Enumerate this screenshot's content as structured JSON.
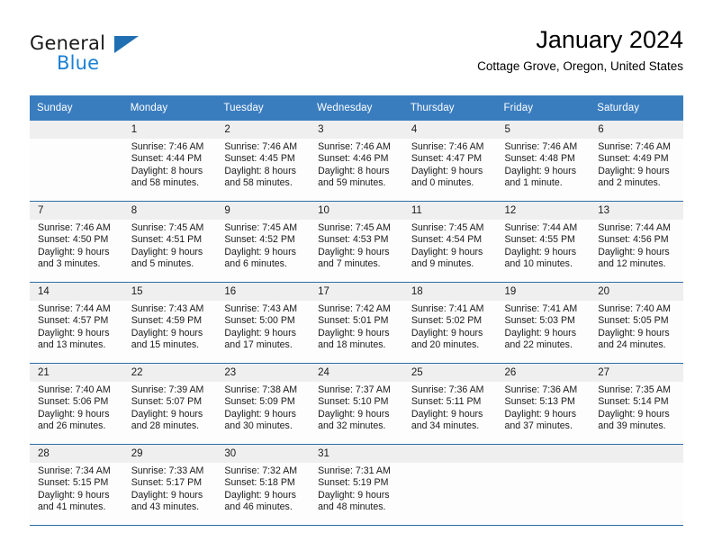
{
  "brand": {
    "name_part1": "General",
    "name_part2": "Blue",
    "accent_color": "#1a7fd4",
    "triangle_color": "#1f6fb2"
  },
  "header": {
    "title": "January 2024",
    "subtitle": "Cottage Grove, Oregon, United States"
  },
  "calendar": {
    "header_bg": "#3a7dbf",
    "daynum_bg": "#efefef",
    "rule_color": "#2c6da8",
    "weekday_headers": [
      "Sunday",
      "Monday",
      "Tuesday",
      "Wednesday",
      "Thursday",
      "Friday",
      "Saturday"
    ],
    "weeks": [
      [
        {
          "day": "",
          "empty": true
        },
        {
          "day": "1",
          "sunrise": "Sunrise: 7:46 AM",
          "sunset": "Sunset: 4:44 PM",
          "daylight1": "Daylight: 8 hours",
          "daylight2": "and 58 minutes."
        },
        {
          "day": "2",
          "sunrise": "Sunrise: 7:46 AM",
          "sunset": "Sunset: 4:45 PM",
          "daylight1": "Daylight: 8 hours",
          "daylight2": "and 58 minutes."
        },
        {
          "day": "3",
          "sunrise": "Sunrise: 7:46 AM",
          "sunset": "Sunset: 4:46 PM",
          "daylight1": "Daylight: 8 hours",
          "daylight2": "and 59 minutes."
        },
        {
          "day": "4",
          "sunrise": "Sunrise: 7:46 AM",
          "sunset": "Sunset: 4:47 PM",
          "daylight1": "Daylight: 9 hours",
          "daylight2": "and 0 minutes."
        },
        {
          "day": "5",
          "sunrise": "Sunrise: 7:46 AM",
          "sunset": "Sunset: 4:48 PM",
          "daylight1": "Daylight: 9 hours",
          "daylight2": "and 1 minute."
        },
        {
          "day": "6",
          "sunrise": "Sunrise: 7:46 AM",
          "sunset": "Sunset: 4:49 PM",
          "daylight1": "Daylight: 9 hours",
          "daylight2": "and 2 minutes."
        }
      ],
      [
        {
          "day": "7",
          "sunrise": "Sunrise: 7:46 AM",
          "sunset": "Sunset: 4:50 PM",
          "daylight1": "Daylight: 9 hours",
          "daylight2": "and 3 minutes."
        },
        {
          "day": "8",
          "sunrise": "Sunrise: 7:45 AM",
          "sunset": "Sunset: 4:51 PM",
          "daylight1": "Daylight: 9 hours",
          "daylight2": "and 5 minutes."
        },
        {
          "day": "9",
          "sunrise": "Sunrise: 7:45 AM",
          "sunset": "Sunset: 4:52 PM",
          "daylight1": "Daylight: 9 hours",
          "daylight2": "and 6 minutes."
        },
        {
          "day": "10",
          "sunrise": "Sunrise: 7:45 AM",
          "sunset": "Sunset: 4:53 PM",
          "daylight1": "Daylight: 9 hours",
          "daylight2": "and 7 minutes."
        },
        {
          "day": "11",
          "sunrise": "Sunrise: 7:45 AM",
          "sunset": "Sunset: 4:54 PM",
          "daylight1": "Daylight: 9 hours",
          "daylight2": "and 9 minutes."
        },
        {
          "day": "12",
          "sunrise": "Sunrise: 7:44 AM",
          "sunset": "Sunset: 4:55 PM",
          "daylight1": "Daylight: 9 hours",
          "daylight2": "and 10 minutes."
        },
        {
          "day": "13",
          "sunrise": "Sunrise: 7:44 AM",
          "sunset": "Sunset: 4:56 PM",
          "daylight1": "Daylight: 9 hours",
          "daylight2": "and 12 minutes."
        }
      ],
      [
        {
          "day": "14",
          "sunrise": "Sunrise: 7:44 AM",
          "sunset": "Sunset: 4:57 PM",
          "daylight1": "Daylight: 9 hours",
          "daylight2": "and 13 minutes."
        },
        {
          "day": "15",
          "sunrise": "Sunrise: 7:43 AM",
          "sunset": "Sunset: 4:59 PM",
          "daylight1": "Daylight: 9 hours",
          "daylight2": "and 15 minutes."
        },
        {
          "day": "16",
          "sunrise": "Sunrise: 7:43 AM",
          "sunset": "Sunset: 5:00 PM",
          "daylight1": "Daylight: 9 hours",
          "daylight2": "and 17 minutes."
        },
        {
          "day": "17",
          "sunrise": "Sunrise: 7:42 AM",
          "sunset": "Sunset: 5:01 PM",
          "daylight1": "Daylight: 9 hours",
          "daylight2": "and 18 minutes."
        },
        {
          "day": "18",
          "sunrise": "Sunrise: 7:41 AM",
          "sunset": "Sunset: 5:02 PM",
          "daylight1": "Daylight: 9 hours",
          "daylight2": "and 20 minutes."
        },
        {
          "day": "19",
          "sunrise": "Sunrise: 7:41 AM",
          "sunset": "Sunset: 5:03 PM",
          "daylight1": "Daylight: 9 hours",
          "daylight2": "and 22 minutes."
        },
        {
          "day": "20",
          "sunrise": "Sunrise: 7:40 AM",
          "sunset": "Sunset: 5:05 PM",
          "daylight1": "Daylight: 9 hours",
          "daylight2": "and 24 minutes."
        }
      ],
      [
        {
          "day": "21",
          "sunrise": "Sunrise: 7:40 AM",
          "sunset": "Sunset: 5:06 PM",
          "daylight1": "Daylight: 9 hours",
          "daylight2": "and 26 minutes."
        },
        {
          "day": "22",
          "sunrise": "Sunrise: 7:39 AM",
          "sunset": "Sunset: 5:07 PM",
          "daylight1": "Daylight: 9 hours",
          "daylight2": "and 28 minutes."
        },
        {
          "day": "23",
          "sunrise": "Sunrise: 7:38 AM",
          "sunset": "Sunset: 5:09 PM",
          "daylight1": "Daylight: 9 hours",
          "daylight2": "and 30 minutes."
        },
        {
          "day": "24",
          "sunrise": "Sunrise: 7:37 AM",
          "sunset": "Sunset: 5:10 PM",
          "daylight1": "Daylight: 9 hours",
          "daylight2": "and 32 minutes."
        },
        {
          "day": "25",
          "sunrise": "Sunrise: 7:36 AM",
          "sunset": "Sunset: 5:11 PM",
          "daylight1": "Daylight: 9 hours",
          "daylight2": "and 34 minutes."
        },
        {
          "day": "26",
          "sunrise": "Sunrise: 7:36 AM",
          "sunset": "Sunset: 5:13 PM",
          "daylight1": "Daylight: 9 hours",
          "daylight2": "and 37 minutes."
        },
        {
          "day": "27",
          "sunrise": "Sunrise: 7:35 AM",
          "sunset": "Sunset: 5:14 PM",
          "daylight1": "Daylight: 9 hours",
          "daylight2": "and 39 minutes."
        }
      ],
      [
        {
          "day": "28",
          "sunrise": "Sunrise: 7:34 AM",
          "sunset": "Sunset: 5:15 PM",
          "daylight1": "Daylight: 9 hours",
          "daylight2": "and 41 minutes."
        },
        {
          "day": "29",
          "sunrise": "Sunrise: 7:33 AM",
          "sunset": "Sunset: 5:17 PM",
          "daylight1": "Daylight: 9 hours",
          "daylight2": "and 43 minutes."
        },
        {
          "day": "30",
          "sunrise": "Sunrise: 7:32 AM",
          "sunset": "Sunset: 5:18 PM",
          "daylight1": "Daylight: 9 hours",
          "daylight2": "and 46 minutes."
        },
        {
          "day": "31",
          "sunrise": "Sunrise: 7:31 AM",
          "sunset": "Sunset: 5:19 PM",
          "daylight1": "Daylight: 9 hours",
          "daylight2": "and 48 minutes."
        },
        {
          "day": "",
          "empty": true
        },
        {
          "day": "",
          "empty": true
        },
        {
          "day": "",
          "empty": true
        }
      ]
    ]
  }
}
